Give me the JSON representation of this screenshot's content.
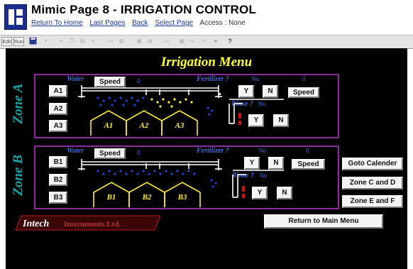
{
  "header": {
    "title": "Mimic Page 8 - IRRIGATION  CONTROL",
    "links": [
      "Return To Home",
      "Last Pages",
      "Back",
      "Select Page"
    ],
    "access": "Access : None"
  },
  "toolbar": {
    "items": [
      {
        "label": "Edit",
        "icon": "edit-icon"
      },
      {
        "label": "Run",
        "icon": "run-icon"
      },
      {
        "label": "",
        "icon": "save-icon"
      },
      {
        "label": "",
        "icon": "undo-icon"
      },
      {
        "label": "",
        "icon": "cut-icon"
      },
      {
        "label": "",
        "icon": "copy-icon"
      },
      {
        "label": "",
        "icon": "paste-icon"
      },
      {
        "label": "",
        "icon": "delete-icon"
      },
      {
        "label": "?",
        "icon": "help-icon"
      }
    ]
  },
  "main": {
    "title": "Irrigation Menu",
    "zones": [
      {
        "label": "Zone A",
        "buttons": [
          "A1",
          "A2",
          "A3"
        ],
        "water_label": "Water",
        "speed_label": "Speed",
        "speed_value": "0",
        "fertilizer_label": "Fertilizer ?",
        "fertilizer_status": "No",
        "fert_speed_value": "0",
        "rinse_label": "Rinse ?",
        "rinse_status": "No",
        "yes": "Y",
        "no": "N",
        "fert_speed_label": "Speed",
        "houses": [
          "A1",
          "A2",
          "A3"
        ]
      },
      {
        "label": "Zone B",
        "buttons": [
          "B1",
          "B2",
          "B3"
        ],
        "water_label": "Water",
        "speed_label": "Speed",
        "speed_value": "0",
        "fertilizer_label": "Fertilizer ?",
        "fertilizer_status": "No",
        "fert_speed_value": "0",
        "rinse_label": "Rinse ?",
        "rinse_status": "No",
        "yes": "Y",
        "no": "N",
        "fert_speed_label": "Speed",
        "houses": [
          "B1",
          "B2",
          "B3"
        ]
      }
    ],
    "side_buttons": [
      "Goto Calender",
      "Zone C and D",
      "Zone E and F"
    ],
    "return_button": "Return to Main Menu",
    "logo": {
      "brand": "Intech",
      "company": "Instruments Ltd."
    }
  },
  "colors": {
    "accent_border": "#8e2a9c",
    "title": "#ffff33",
    "zone_label": "#17a6a6",
    "water_drops": "#2244dd",
    "fertilizer_dots": "#ffee33"
  }
}
